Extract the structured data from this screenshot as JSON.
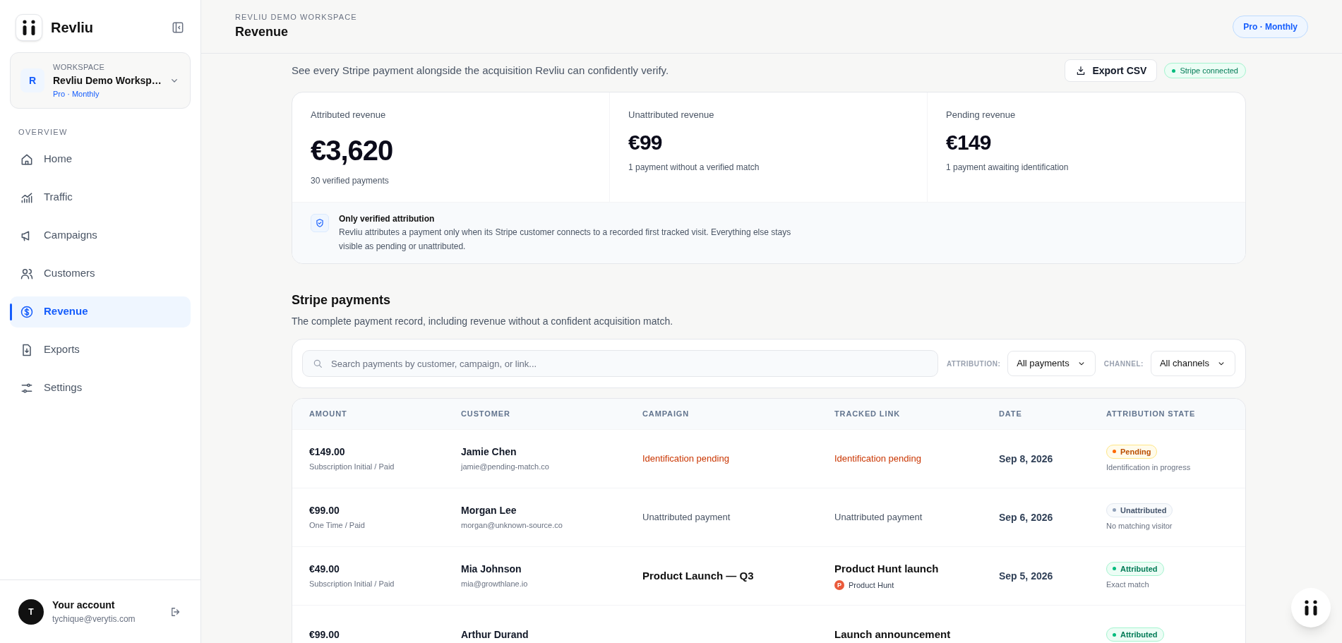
{
  "sidebar": {
    "brand": "Revliu",
    "workspace": {
      "initial": "R",
      "label": "WORKSPACE",
      "name": "Revliu Demo Worksp…",
      "plan": "Pro · Monthly"
    },
    "section": "OVERVIEW",
    "items": [
      {
        "label": "Home",
        "selected": false
      },
      {
        "label": "Traffic",
        "selected": false
      },
      {
        "label": "Campaigns",
        "selected": false
      },
      {
        "label": "Customers",
        "selected": false
      },
      {
        "label": "Revenue",
        "selected": true
      },
      {
        "label": "Exports",
        "selected": false
      },
      {
        "label": "Settings",
        "selected": false
      }
    ],
    "account": {
      "initial": "T",
      "name": "Your account",
      "email": "tychique@verytis.com"
    }
  },
  "header": {
    "eyebrow": "REVLIU DEMO WORKSPACE",
    "title": "Revenue",
    "plan_badge": "Pro · Monthly"
  },
  "intro": {
    "text": "See every Stripe payment alongside the acquisition Revliu can confidently verify.",
    "export_button": "Export CSV",
    "connection_badge": "Stripe connected"
  },
  "metrics": [
    {
      "label": "Attributed revenue",
      "value": "€3,620",
      "note": "30 verified payments",
      "primary": true
    },
    {
      "label": "Unattributed revenue",
      "value": "€99",
      "note": "1 payment without a verified match",
      "primary": false
    },
    {
      "label": "Pending revenue",
      "value": "€149",
      "note": "1 payment awaiting identification",
      "primary": false
    }
  ],
  "notice": {
    "title": "Only verified attribution",
    "text": "Revliu attributes a payment only when its Stripe customer connects to a recorded first tracked visit. Everything else stays visible as pending or unattributed."
  },
  "payments": {
    "title": "Stripe payments",
    "subtitle": "The complete payment record, including revenue without a confident acquisition match.",
    "search": {
      "placeholder": "Search payments by customer, campaign, or link..."
    },
    "filters": [
      {
        "label": "ATTRIBUTION:",
        "value": "All payments"
      },
      {
        "label": "CHANNEL:",
        "value": "All channels"
      }
    ],
    "columns": [
      "AMOUNT",
      "CUSTOMER",
      "CAMPAIGN",
      "TRACKED LINK",
      "DATE",
      "ATTRIBUTION STATE"
    ],
    "rows": [
      {
        "amount": "€149.00",
        "amount_detail": "Subscription Initial / Paid",
        "customer": "Jamie Chen",
        "email": "jamie@pending-match.co",
        "kind": "pending",
        "campaign": "Identification pending",
        "link": "Identification pending",
        "date": "Sep 8, 2026",
        "state": "Pending",
        "state_note": "Identification in progress"
      },
      {
        "amount": "€99.00",
        "amount_detail": "One Time / Paid",
        "customer": "Morgan Lee",
        "email": "morgan@unknown-source.co",
        "kind": "unattributed",
        "campaign": "Unattributed payment",
        "link": "Unattributed payment",
        "date": "Sep 6, 2026",
        "state": "Unattributed",
        "state_note": "No matching visitor"
      },
      {
        "amount": "€49.00",
        "amount_detail": "Subscription Initial / Paid",
        "customer": "Mia Johnson",
        "email": "mia@growthlane.io",
        "kind": "attributed",
        "campaign": "Product Launch — Q3",
        "link": "Product Hunt launch",
        "source_mark": "P",
        "source": "Product Hunt",
        "date": "Sep 5, 2026",
        "state": "Attributed",
        "state_note": "Exact match"
      },
      {
        "amount": "€99.00",
        "customer": "Arthur Durand",
        "kind": "attributed",
        "link": "Launch announcement",
        "state": "Attributed"
      }
    ]
  }
}
